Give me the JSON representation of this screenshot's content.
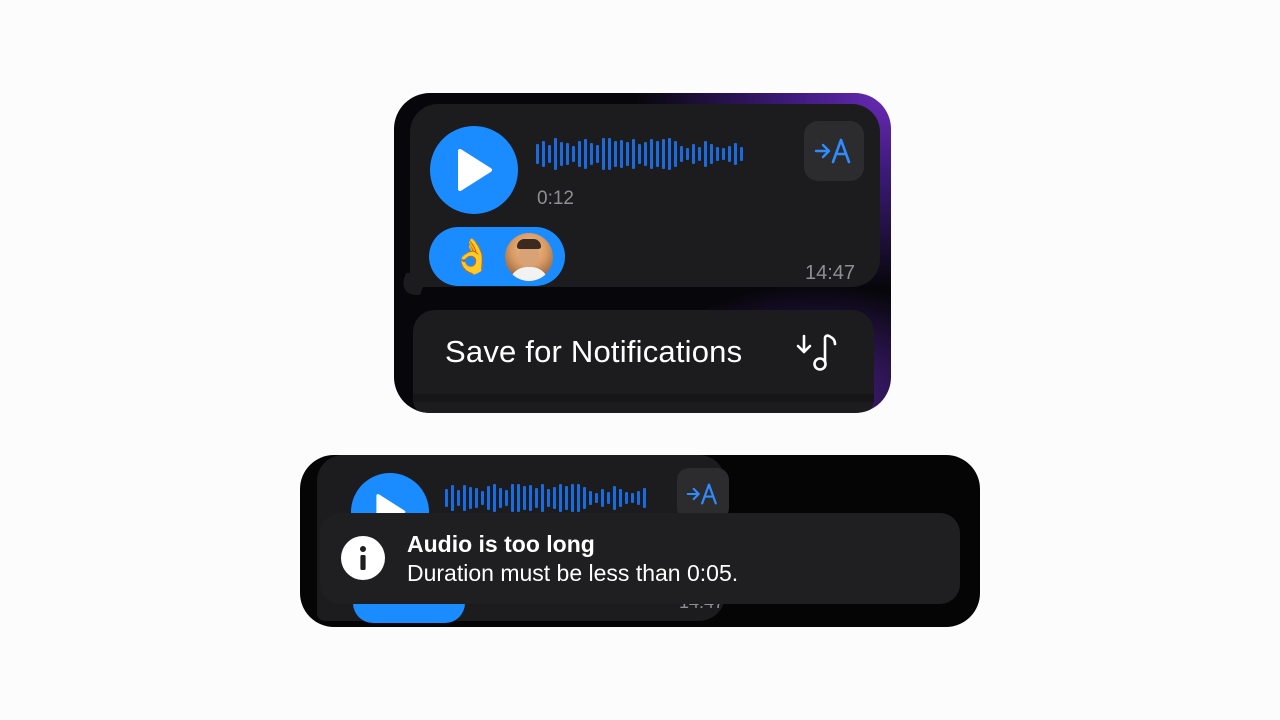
{
  "voice_message": {
    "duration": "0:12",
    "time": "14:47",
    "reaction_emoji": "👌",
    "play_icon": "play-icon",
    "translate_icon": "translate-icon"
  },
  "context_menu": {
    "items": [
      {
        "label": "Save for Notifications",
        "icon": "save-notification-sound-icon"
      }
    ]
  },
  "voice_message_behind_toast": {
    "time": "14:47"
  },
  "toast": {
    "title": "Audio is too long",
    "message": "Duration must be less than 0:05.",
    "icon": "info-icon"
  },
  "colors": {
    "accent": "#1a8cff",
    "bubble": "#1c1c1e",
    "waveform": "#1a6ae0",
    "secondary_text": "#8e8e93",
    "glow": "#6a2bb8"
  }
}
